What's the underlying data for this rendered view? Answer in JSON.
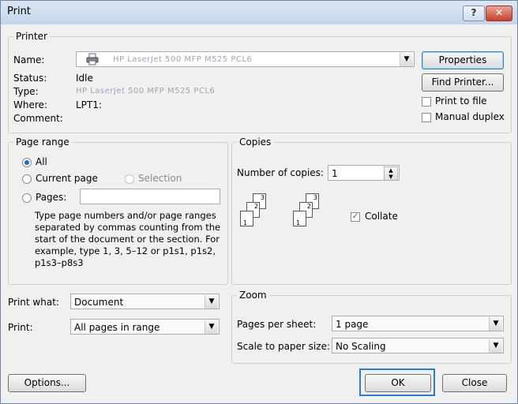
{
  "window": {
    "title": "Print",
    "help_label": "?",
    "close_label": "✕"
  },
  "printer": {
    "legend": "Printer",
    "name_label": "Name:",
    "name_value": "HP LaserJet 500 MFP M525 PCL6",
    "status_label": "Status:",
    "status_value": "Idle",
    "type_label": "Type:",
    "type_value": "HP LaserJet 500 MFP M525 PCL6",
    "where_label": "Where:",
    "where_value": "LPT1:",
    "comment_label": "Comment:",
    "comment_value": "",
    "properties_label": "Properties",
    "find_printer_label": "Find Printer...",
    "print_to_file_label": "Print to file",
    "manual_duplex_label": "Manual duplex"
  },
  "page_range": {
    "legend": "Page range",
    "all_label": "All",
    "current_page_label": "Current page",
    "selection_label": "Selection",
    "pages_label": "Pages:",
    "pages_value": "",
    "help_text": "Type page numbers and/or page ranges separated by commas counting from the start of the document or the section. For example, type 1, 3, 5–12 or p1s1, p1s2, p1s3–p8s3"
  },
  "copies": {
    "legend": "Copies",
    "number_label": "Number of copies:",
    "number_value": "1",
    "collate_label": "Collate",
    "collate_checked": true
  },
  "print_what": {
    "label": "Print what:",
    "value": "Document"
  },
  "print_sel": {
    "label": "Print:",
    "value": "All pages in range"
  },
  "zoom": {
    "legend": "Zoom",
    "pages_per_sheet_label": "Pages per sheet:",
    "pages_per_sheet_value": "1 page",
    "scale_label": "Scale to paper size:",
    "scale_value": "No Scaling"
  },
  "footer": {
    "options_label": "Options...",
    "ok_label": "OK",
    "close_label": "Close"
  },
  "icons": {
    "printer": "printer-icon",
    "spin": "spin-arrows-icon",
    "dropdown": "chevron-down-icon"
  }
}
